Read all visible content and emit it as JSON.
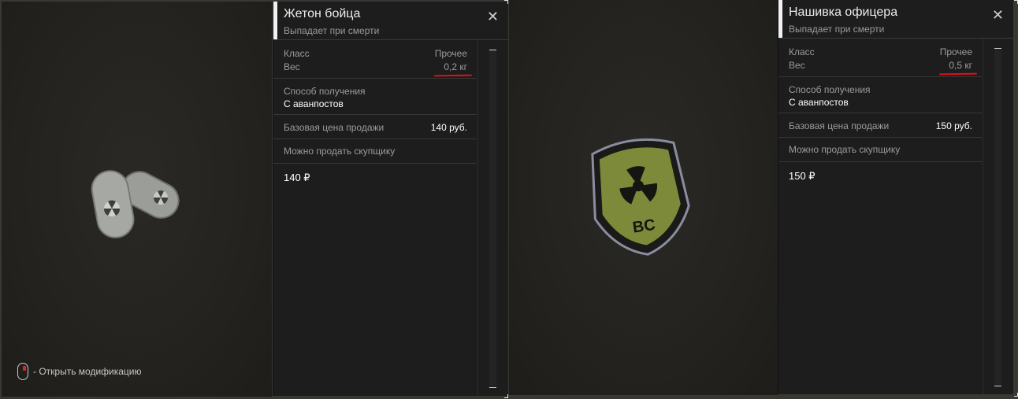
{
  "left_card": {
    "title": "Жетон бойца",
    "subtitle": "Выпадает при смерти",
    "class_label": "Класс",
    "class_value": "Прочее",
    "weight_label": "Вес",
    "weight_value": "0,2 кг",
    "source_label": "Способ получения",
    "source_value": "С аванпостов",
    "base_price_label": "Базовая цена продажи",
    "base_price_value": "140 руб.",
    "sellable_label": "Можно продать скупщику",
    "cost": "140 ₽",
    "item_icon": "dog-tags-icon"
  },
  "right_card": {
    "title": "Нашивка офицера",
    "subtitle": "Выпадает при смерти",
    "class_label": "Класс",
    "class_value": "Прочее",
    "weight_label": "Вес",
    "weight_value": "0,5 кг",
    "source_label": "Способ получения",
    "source_value": "С аванпостов",
    "base_price_label": "Базовая цена продажи",
    "base_price_value": "150 руб.",
    "sellable_label": "Можно продать скупщику",
    "cost": "150 ₽",
    "item_icon": "patch-icon"
  },
  "hint": {
    "text": "- Открыть модификацию",
    "icon": "mouse-icon"
  },
  "close_glyph": "✕",
  "colors": {
    "accent": "#f2f2f2",
    "highlight": "#e0101c"
  }
}
